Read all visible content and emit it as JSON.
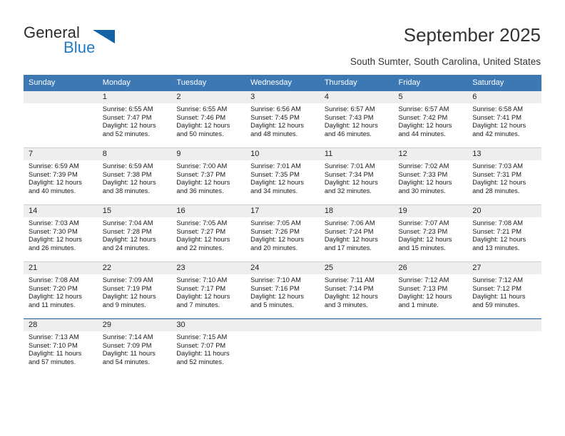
{
  "logo": {
    "word_one": "General",
    "word_two": "Blue",
    "triangle_color": "#1362a4",
    "blue_text_color": "#1f7ac4"
  },
  "header": {
    "title": "September 2025",
    "subtitle": "South Sumter, South Carolina, United States",
    "header_bar_color": "#3c78b4",
    "day_band_color": "#eeeeee"
  },
  "weekdays": [
    "Sunday",
    "Monday",
    "Tuesday",
    "Wednesday",
    "Thursday",
    "Friday",
    "Saturday"
  ],
  "labels": {
    "sunrise_prefix": "Sunrise:",
    "sunset_prefix": "Sunset:",
    "daylight_prefix": "Daylight:"
  },
  "weeks": [
    [
      {
        "day": "",
        "empty": true
      },
      {
        "day": "1",
        "sunrise": "Sunrise: 6:55 AM",
        "sunset": "Sunset: 7:47 PM",
        "daylight_line1": "Daylight: 12 hours",
        "daylight_line2": "and 52 minutes."
      },
      {
        "day": "2",
        "sunrise": "Sunrise: 6:55 AM",
        "sunset": "Sunset: 7:46 PM",
        "daylight_line1": "Daylight: 12 hours",
        "daylight_line2": "and 50 minutes."
      },
      {
        "day": "3",
        "sunrise": "Sunrise: 6:56 AM",
        "sunset": "Sunset: 7:45 PM",
        "daylight_line1": "Daylight: 12 hours",
        "daylight_line2": "and 48 minutes."
      },
      {
        "day": "4",
        "sunrise": "Sunrise: 6:57 AM",
        "sunset": "Sunset: 7:43 PM",
        "daylight_line1": "Daylight: 12 hours",
        "daylight_line2": "and 46 minutes."
      },
      {
        "day": "5",
        "sunrise": "Sunrise: 6:57 AM",
        "sunset": "Sunset: 7:42 PM",
        "daylight_line1": "Daylight: 12 hours",
        "daylight_line2": "and 44 minutes."
      },
      {
        "day": "6",
        "sunrise": "Sunrise: 6:58 AM",
        "sunset": "Sunset: 7:41 PM",
        "daylight_line1": "Daylight: 12 hours",
        "daylight_line2": "and 42 minutes."
      }
    ],
    [
      {
        "day": "7",
        "sunrise": "Sunrise: 6:59 AM",
        "sunset": "Sunset: 7:39 PM",
        "daylight_line1": "Daylight: 12 hours",
        "daylight_line2": "and 40 minutes."
      },
      {
        "day": "8",
        "sunrise": "Sunrise: 6:59 AM",
        "sunset": "Sunset: 7:38 PM",
        "daylight_line1": "Daylight: 12 hours",
        "daylight_line2": "and 38 minutes."
      },
      {
        "day": "9",
        "sunrise": "Sunrise: 7:00 AM",
        "sunset": "Sunset: 7:37 PM",
        "daylight_line1": "Daylight: 12 hours",
        "daylight_line2": "and 36 minutes."
      },
      {
        "day": "10",
        "sunrise": "Sunrise: 7:01 AM",
        "sunset": "Sunset: 7:35 PM",
        "daylight_line1": "Daylight: 12 hours",
        "daylight_line2": "and 34 minutes."
      },
      {
        "day": "11",
        "sunrise": "Sunrise: 7:01 AM",
        "sunset": "Sunset: 7:34 PM",
        "daylight_line1": "Daylight: 12 hours",
        "daylight_line2": "and 32 minutes."
      },
      {
        "day": "12",
        "sunrise": "Sunrise: 7:02 AM",
        "sunset": "Sunset: 7:33 PM",
        "daylight_line1": "Daylight: 12 hours",
        "daylight_line2": "and 30 minutes."
      },
      {
        "day": "13",
        "sunrise": "Sunrise: 7:03 AM",
        "sunset": "Sunset: 7:31 PM",
        "daylight_line1": "Daylight: 12 hours",
        "daylight_line2": "and 28 minutes."
      }
    ],
    [
      {
        "day": "14",
        "sunrise": "Sunrise: 7:03 AM",
        "sunset": "Sunset: 7:30 PM",
        "daylight_line1": "Daylight: 12 hours",
        "daylight_line2": "and 26 minutes."
      },
      {
        "day": "15",
        "sunrise": "Sunrise: 7:04 AM",
        "sunset": "Sunset: 7:28 PM",
        "daylight_line1": "Daylight: 12 hours",
        "daylight_line2": "and 24 minutes."
      },
      {
        "day": "16",
        "sunrise": "Sunrise: 7:05 AM",
        "sunset": "Sunset: 7:27 PM",
        "daylight_line1": "Daylight: 12 hours",
        "daylight_line2": "and 22 minutes."
      },
      {
        "day": "17",
        "sunrise": "Sunrise: 7:05 AM",
        "sunset": "Sunset: 7:26 PM",
        "daylight_line1": "Daylight: 12 hours",
        "daylight_line2": "and 20 minutes."
      },
      {
        "day": "18",
        "sunrise": "Sunrise: 7:06 AM",
        "sunset": "Sunset: 7:24 PM",
        "daylight_line1": "Daylight: 12 hours",
        "daylight_line2": "and 17 minutes."
      },
      {
        "day": "19",
        "sunrise": "Sunrise: 7:07 AM",
        "sunset": "Sunset: 7:23 PM",
        "daylight_line1": "Daylight: 12 hours",
        "daylight_line2": "and 15 minutes."
      },
      {
        "day": "20",
        "sunrise": "Sunrise: 7:08 AM",
        "sunset": "Sunset: 7:21 PM",
        "daylight_line1": "Daylight: 12 hours",
        "daylight_line2": "and 13 minutes."
      }
    ],
    [
      {
        "day": "21",
        "sunrise": "Sunrise: 7:08 AM",
        "sunset": "Sunset: 7:20 PM",
        "daylight_line1": "Daylight: 12 hours",
        "daylight_line2": "and 11 minutes."
      },
      {
        "day": "22",
        "sunrise": "Sunrise: 7:09 AM",
        "sunset": "Sunset: 7:19 PM",
        "daylight_line1": "Daylight: 12 hours",
        "daylight_line2": "and 9 minutes."
      },
      {
        "day": "23",
        "sunrise": "Sunrise: 7:10 AM",
        "sunset": "Sunset: 7:17 PM",
        "daylight_line1": "Daylight: 12 hours",
        "daylight_line2": "and 7 minutes."
      },
      {
        "day": "24",
        "sunrise": "Sunrise: 7:10 AM",
        "sunset": "Sunset: 7:16 PM",
        "daylight_line1": "Daylight: 12 hours",
        "daylight_line2": "and 5 minutes."
      },
      {
        "day": "25",
        "sunrise": "Sunrise: 7:11 AM",
        "sunset": "Sunset: 7:14 PM",
        "daylight_line1": "Daylight: 12 hours",
        "daylight_line2": "and 3 minutes."
      },
      {
        "day": "26",
        "sunrise": "Sunrise: 7:12 AM",
        "sunset": "Sunset: 7:13 PM",
        "daylight_line1": "Daylight: 12 hours",
        "daylight_line2": "and 1 minute."
      },
      {
        "day": "27",
        "sunrise": "Sunrise: 7:12 AM",
        "sunset": "Sunset: 7:12 PM",
        "daylight_line1": "Daylight: 11 hours",
        "daylight_line2": "and 59 minutes."
      }
    ],
    [
      {
        "day": "28",
        "sunrise": "Sunrise: 7:13 AM",
        "sunset": "Sunset: 7:10 PM",
        "daylight_line1": "Daylight: 11 hours",
        "daylight_line2": "and 57 minutes."
      },
      {
        "day": "29",
        "sunrise": "Sunrise: 7:14 AM",
        "sunset": "Sunset: 7:09 PM",
        "daylight_line1": "Daylight: 11 hours",
        "daylight_line2": "and 54 minutes."
      },
      {
        "day": "30",
        "sunrise": "Sunrise: 7:15 AM",
        "sunset": "Sunset: 7:07 PM",
        "daylight_line1": "Daylight: 11 hours",
        "daylight_line2": "and 52 minutes."
      },
      {
        "day": "",
        "empty": true
      },
      {
        "day": "",
        "empty": true
      },
      {
        "day": "",
        "empty": true
      },
      {
        "day": "",
        "empty": true
      }
    ]
  ]
}
